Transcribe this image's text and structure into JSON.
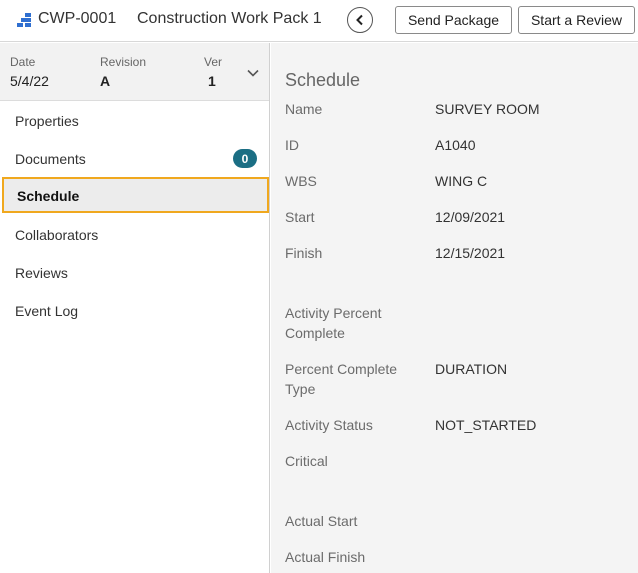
{
  "header": {
    "app_icon": "stacked-blocks-icon",
    "package_id": "CWP-0001",
    "package_title": "Construction Work Pack 1",
    "back_icon": "chevron-left-icon",
    "send_label": "Send Package",
    "review_label": "Start a Review"
  },
  "meta": {
    "date_label": "Date",
    "date_value": "5/4/22",
    "revision_label": "Revision",
    "revision_value": "A",
    "ver_label": "Ver",
    "ver_value": "1"
  },
  "nav": {
    "items": [
      {
        "label": "Properties"
      },
      {
        "label": "Documents",
        "badge": "0"
      },
      {
        "label": "Schedule",
        "active": true
      },
      {
        "label": "Collaborators"
      },
      {
        "label": "Reviews"
      },
      {
        "label": "Event Log"
      }
    ]
  },
  "schedule": {
    "title": "Schedule",
    "fields": [
      {
        "label": "Name",
        "value": "SURVEY ROOM"
      },
      {
        "label": "ID",
        "value": "A1040"
      },
      {
        "label": "WBS",
        "value": "WING C"
      },
      {
        "label": "Start",
        "value": "12/09/2021"
      },
      {
        "label": "Finish",
        "value": "12/15/2021"
      },
      {
        "label": "Activity Percent Complete",
        "value": ""
      },
      {
        "label": "Percent Complete Type",
        "value": "DURATION"
      },
      {
        "label": "Activity Status",
        "value": "NOT_STARTED"
      },
      {
        "label": "Critical",
        "value": ""
      },
      {
        "label": "Actual Start",
        "value": ""
      },
      {
        "label": "Actual Finish",
        "value": ""
      }
    ]
  },
  "colors": {
    "accent_outline": "#f0a81e",
    "badge": "#1b6e84",
    "app_icon": "#2f6fd0"
  }
}
